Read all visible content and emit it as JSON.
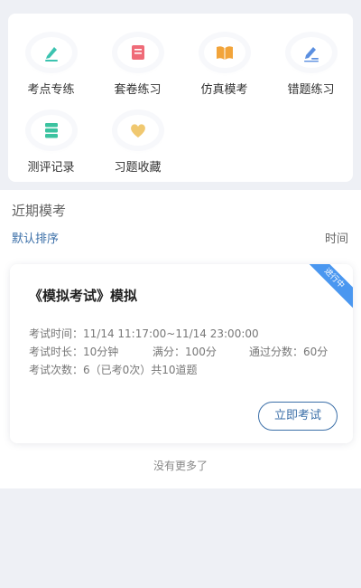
{
  "grid": {
    "items": [
      {
        "label": "考点专练",
        "icon": "pen-icon"
      },
      {
        "label": "套卷练习",
        "icon": "book-icon"
      },
      {
        "label": "仿真模考",
        "icon": "open-book-icon"
      },
      {
        "label": "错题练习",
        "icon": "edit-icon"
      },
      {
        "label": "测评记录",
        "icon": "record-stack-icon"
      },
      {
        "label": "习题收藏",
        "icon": "heart-icon"
      }
    ]
  },
  "list": {
    "section_title": "近期模考",
    "sort_default": "默认排序",
    "sort_time": "时间"
  },
  "exam": {
    "status": "进行中",
    "title": "《模拟考试》模拟",
    "time_line": "考试时间：11/14 11:17:00~11/14 23:00:00",
    "duration": "考试时长：10分钟",
    "full_score": "满分：100分",
    "pass_score": "通过分数：60分",
    "attempts": "考试次数：6（已考0次）共10道题",
    "start_label": "立即考试"
  },
  "footer": {
    "no_more": "没有更多了"
  },
  "colors": {
    "accent": "#3b6fa8",
    "ribbon": "#4a97f0",
    "background": "#eef0f5"
  }
}
